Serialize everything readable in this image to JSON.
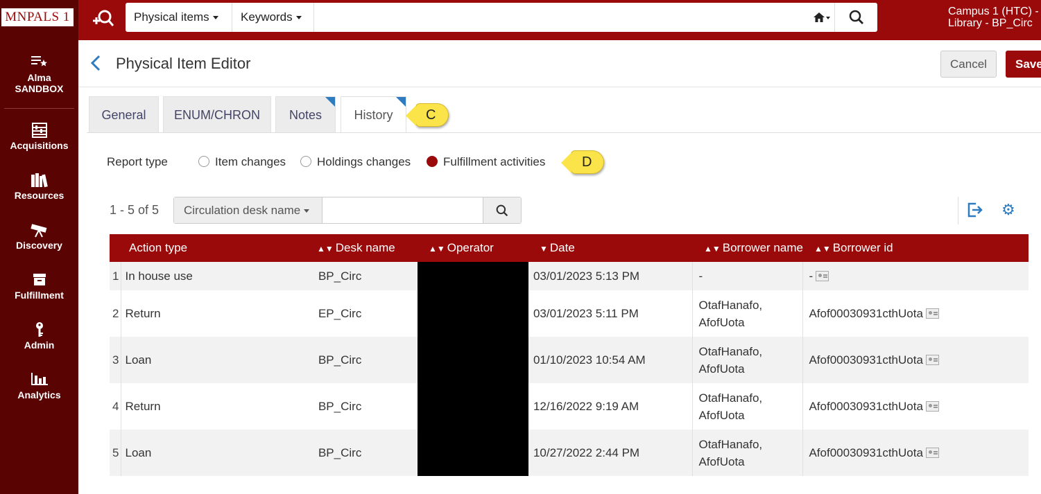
{
  "app": {
    "logo": "MNPALS 1",
    "search_scope": "Physical items",
    "search_field": "Keywords",
    "search_query": "",
    "user_location_line1": "Campus 1 (HTC) -",
    "user_location_line2": "Library - BP_Circ"
  },
  "sidebar": {
    "items": [
      {
        "label_line1": "Alma",
        "label_line2": "SANDBOX",
        "icon": "list-star-icon"
      },
      {
        "label": "Acquisitions",
        "icon": "abacus-icon"
      },
      {
        "label": "Resources",
        "icon": "books-icon"
      },
      {
        "label": "Discovery",
        "icon": "telescope-icon"
      },
      {
        "label": "Fulfillment",
        "icon": "box-icon"
      },
      {
        "label": "Admin",
        "icon": "key-icon"
      },
      {
        "label": "Analytics",
        "icon": "bar-chart-icon"
      }
    ]
  },
  "page": {
    "title": "Physical Item Editor",
    "cancel_label": "Cancel",
    "save_label": "Save"
  },
  "tabs": [
    {
      "label": "General",
      "active": false
    },
    {
      "label": "ENUM/CHRON",
      "active": false
    },
    {
      "label": "Notes",
      "active": false
    },
    {
      "label": "History",
      "active": true
    }
  ],
  "callouts": {
    "tabs": "C",
    "report_type": "D"
  },
  "report": {
    "label": "Report type",
    "options": [
      {
        "label": "Item changes",
        "checked": false
      },
      {
        "label": "Holdings changes",
        "checked": false
      },
      {
        "label": "Fulfillment activities",
        "checked": true
      }
    ]
  },
  "list": {
    "count": "1 - 5 of 5",
    "filter_field": "Circulation desk name",
    "filter_value": ""
  },
  "table": {
    "columns": [
      "Action type",
      "Desk name",
      "Operator",
      "Date",
      "Borrower name",
      "Borrower id"
    ],
    "rows": [
      {
        "num": "1",
        "action": "In house use",
        "desk": "BP_Circ",
        "date": "03/01/2023 5:13 PM",
        "name1": "-",
        "name2": "",
        "bid": "-"
      },
      {
        "num": "2",
        "action": "Return",
        "desk": "EP_Circ",
        "date": "03/01/2023 5:11 PM",
        "name1": "OtafHanafo,",
        "name2": "AfofUota",
        "bid": "Afof00030931cthUota"
      },
      {
        "num": "3",
        "action": "Loan",
        "desk": "BP_Circ",
        "date": "01/10/2023 10:54 AM",
        "name1": "OtafHanafo,",
        "name2": "AfofUota",
        "bid": "Afof00030931cthUota"
      },
      {
        "num": "4",
        "action": "Return",
        "desk": "BP_Circ",
        "date": "12/16/2022 9:19 AM",
        "name1": "OtafHanafo,",
        "name2": "AfofUota",
        "bid": "Afof00030931cthUota"
      },
      {
        "num": "5",
        "action": "Loan",
        "desk": "BP_Circ",
        "date": "10/27/2022 2:44 PM",
        "name1": "OtafHanafo,",
        "name2": "AfofUota",
        "bid": "Afof00030931cthUota"
      }
    ]
  }
}
